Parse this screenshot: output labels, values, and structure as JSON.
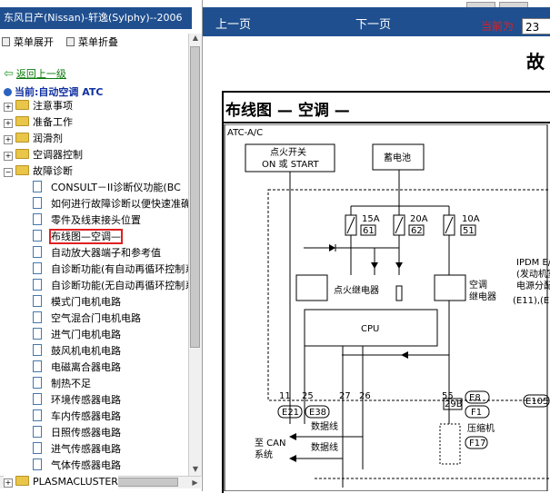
{
  "sidebar": {
    "title": "东风日产(Nissan)-轩逸(Sylphy)--2006",
    "expand_label": "菜单展开",
    "collapse_label": "菜单折叠",
    "back_label": "返回上一级",
    "current_label": "当前:自动空调 ATC",
    "folders": [
      {
        "label": "注意事项"
      },
      {
        "label": "准备工作"
      },
      {
        "label": "润滑剂"
      },
      {
        "label": "空调器控制"
      },
      {
        "label": "故障诊断"
      }
    ],
    "docs": [
      {
        "label": "CONSULT－II诊断仪功能(BC"
      },
      {
        "label": "如何进行故障诊断以便快速准确修"
      },
      {
        "label": "零件及线束接头位置"
      },
      {
        "label": "布线图—空调—"
      },
      {
        "label": "自动放大器端子和参考值"
      },
      {
        "label": "自诊断功能(有自动再循环控制系"
      },
      {
        "label": "自诊断功能(无自动再循环控制系"
      },
      {
        "label": "模式门电机电路"
      },
      {
        "label": "空气混合门电机电路"
      },
      {
        "label": "进气门电机电路"
      },
      {
        "label": "鼓风机电机电路"
      },
      {
        "label": "电磁离合器电路"
      },
      {
        "label": "制热不足"
      },
      {
        "label": "环境传感器电路"
      },
      {
        "label": "车内传感器电路"
      },
      {
        "label": "日照传感器电路"
      },
      {
        "label": "进气传感器电路"
      },
      {
        "label": "气体传感器电路"
      }
    ],
    "bottom_folder": "PLASMACLUSTER"
  },
  "nav": {
    "prev_label": "上一页",
    "next_label": "下一页",
    "current_page_label": "当前为",
    "current_page_value": "23"
  },
  "document": {
    "title_fragment": "故",
    "heading": "布线图 — 空调 —",
    "diagram": {
      "label": "ATC-A/C",
      "ignition": "点火开关",
      "ignition_state": "ON 或 START",
      "battery": "蓄电池",
      "fuses": [
        {
          "amp": "15A",
          "no": "61"
        },
        {
          "amp": "20A",
          "no": "62"
        },
        {
          "amp": "10A",
          "no": "51"
        }
      ],
      "ipdm_lines": [
        "IPDM E/R",
        "(发动机室",
        "电源分配",
        "(E11),(E"
      ],
      "relay_ignition": "点火继电器",
      "relay_ac_1": "空调",
      "relay_ac_2": "继电器",
      "cpu": "CPU",
      "pins": [
        "11",
        "25",
        "27",
        "26",
        "55"
      ],
      "connectors": [
        "E21",
        "E38",
        "E8",
        "F1",
        "E105",
        "F17"
      ],
      "connector_29b": "29B",
      "to_can": "至 CAN",
      "system": "系统",
      "dataline1": "数据线",
      "dataline2": "数据线",
      "compressor": "压缩机"
    }
  }
}
